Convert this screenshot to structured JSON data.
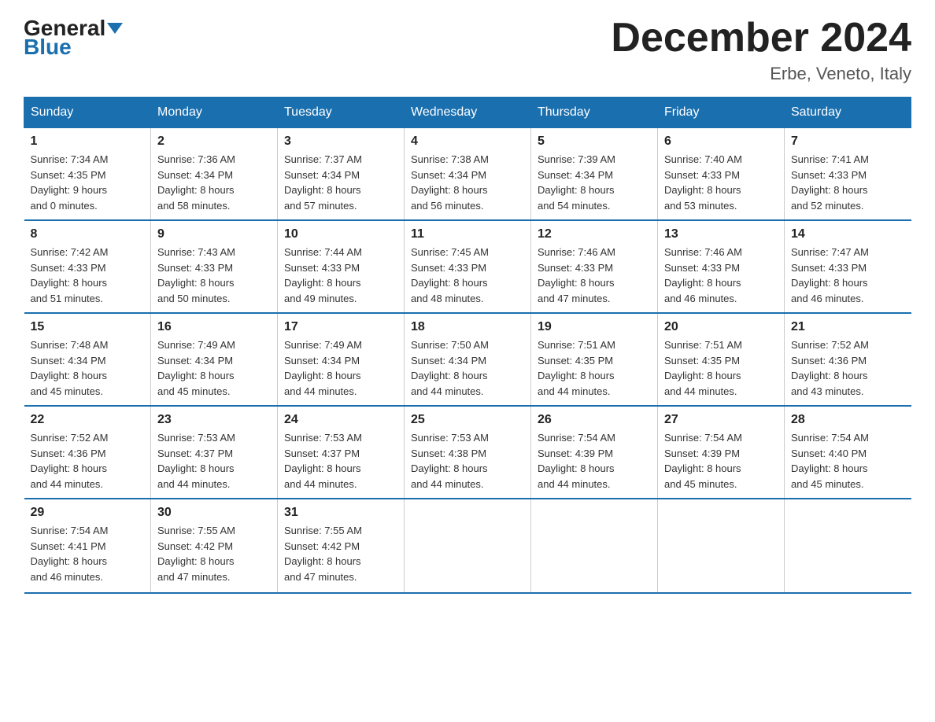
{
  "header": {
    "logo_general": "General",
    "logo_blue": "Blue",
    "title": "December 2024",
    "subtitle": "Erbe, Veneto, Italy"
  },
  "days_of_week": [
    "Sunday",
    "Monday",
    "Tuesday",
    "Wednesday",
    "Thursday",
    "Friday",
    "Saturday"
  ],
  "weeks": [
    [
      {
        "num": "1",
        "info": "Sunrise: 7:34 AM\nSunset: 4:35 PM\nDaylight: 9 hours\nand 0 minutes."
      },
      {
        "num": "2",
        "info": "Sunrise: 7:36 AM\nSunset: 4:34 PM\nDaylight: 8 hours\nand 58 minutes."
      },
      {
        "num": "3",
        "info": "Sunrise: 7:37 AM\nSunset: 4:34 PM\nDaylight: 8 hours\nand 57 minutes."
      },
      {
        "num": "4",
        "info": "Sunrise: 7:38 AM\nSunset: 4:34 PM\nDaylight: 8 hours\nand 56 minutes."
      },
      {
        "num": "5",
        "info": "Sunrise: 7:39 AM\nSunset: 4:34 PM\nDaylight: 8 hours\nand 54 minutes."
      },
      {
        "num": "6",
        "info": "Sunrise: 7:40 AM\nSunset: 4:33 PM\nDaylight: 8 hours\nand 53 minutes."
      },
      {
        "num": "7",
        "info": "Sunrise: 7:41 AM\nSunset: 4:33 PM\nDaylight: 8 hours\nand 52 minutes."
      }
    ],
    [
      {
        "num": "8",
        "info": "Sunrise: 7:42 AM\nSunset: 4:33 PM\nDaylight: 8 hours\nand 51 minutes."
      },
      {
        "num": "9",
        "info": "Sunrise: 7:43 AM\nSunset: 4:33 PM\nDaylight: 8 hours\nand 50 minutes."
      },
      {
        "num": "10",
        "info": "Sunrise: 7:44 AM\nSunset: 4:33 PM\nDaylight: 8 hours\nand 49 minutes."
      },
      {
        "num": "11",
        "info": "Sunrise: 7:45 AM\nSunset: 4:33 PM\nDaylight: 8 hours\nand 48 minutes."
      },
      {
        "num": "12",
        "info": "Sunrise: 7:46 AM\nSunset: 4:33 PM\nDaylight: 8 hours\nand 47 minutes."
      },
      {
        "num": "13",
        "info": "Sunrise: 7:46 AM\nSunset: 4:33 PM\nDaylight: 8 hours\nand 46 minutes."
      },
      {
        "num": "14",
        "info": "Sunrise: 7:47 AM\nSunset: 4:33 PM\nDaylight: 8 hours\nand 46 minutes."
      }
    ],
    [
      {
        "num": "15",
        "info": "Sunrise: 7:48 AM\nSunset: 4:34 PM\nDaylight: 8 hours\nand 45 minutes."
      },
      {
        "num": "16",
        "info": "Sunrise: 7:49 AM\nSunset: 4:34 PM\nDaylight: 8 hours\nand 45 minutes."
      },
      {
        "num": "17",
        "info": "Sunrise: 7:49 AM\nSunset: 4:34 PM\nDaylight: 8 hours\nand 44 minutes."
      },
      {
        "num": "18",
        "info": "Sunrise: 7:50 AM\nSunset: 4:34 PM\nDaylight: 8 hours\nand 44 minutes."
      },
      {
        "num": "19",
        "info": "Sunrise: 7:51 AM\nSunset: 4:35 PM\nDaylight: 8 hours\nand 44 minutes."
      },
      {
        "num": "20",
        "info": "Sunrise: 7:51 AM\nSunset: 4:35 PM\nDaylight: 8 hours\nand 44 minutes."
      },
      {
        "num": "21",
        "info": "Sunrise: 7:52 AM\nSunset: 4:36 PM\nDaylight: 8 hours\nand 43 minutes."
      }
    ],
    [
      {
        "num": "22",
        "info": "Sunrise: 7:52 AM\nSunset: 4:36 PM\nDaylight: 8 hours\nand 44 minutes."
      },
      {
        "num": "23",
        "info": "Sunrise: 7:53 AM\nSunset: 4:37 PM\nDaylight: 8 hours\nand 44 minutes."
      },
      {
        "num": "24",
        "info": "Sunrise: 7:53 AM\nSunset: 4:37 PM\nDaylight: 8 hours\nand 44 minutes."
      },
      {
        "num": "25",
        "info": "Sunrise: 7:53 AM\nSunset: 4:38 PM\nDaylight: 8 hours\nand 44 minutes."
      },
      {
        "num": "26",
        "info": "Sunrise: 7:54 AM\nSunset: 4:39 PM\nDaylight: 8 hours\nand 44 minutes."
      },
      {
        "num": "27",
        "info": "Sunrise: 7:54 AM\nSunset: 4:39 PM\nDaylight: 8 hours\nand 45 minutes."
      },
      {
        "num": "28",
        "info": "Sunrise: 7:54 AM\nSunset: 4:40 PM\nDaylight: 8 hours\nand 45 minutes."
      }
    ],
    [
      {
        "num": "29",
        "info": "Sunrise: 7:54 AM\nSunset: 4:41 PM\nDaylight: 8 hours\nand 46 minutes."
      },
      {
        "num": "30",
        "info": "Sunrise: 7:55 AM\nSunset: 4:42 PM\nDaylight: 8 hours\nand 47 minutes."
      },
      {
        "num": "31",
        "info": "Sunrise: 7:55 AM\nSunset: 4:42 PM\nDaylight: 8 hours\nand 47 minutes."
      },
      {
        "num": "",
        "info": ""
      },
      {
        "num": "",
        "info": ""
      },
      {
        "num": "",
        "info": ""
      },
      {
        "num": "",
        "info": ""
      }
    ]
  ]
}
